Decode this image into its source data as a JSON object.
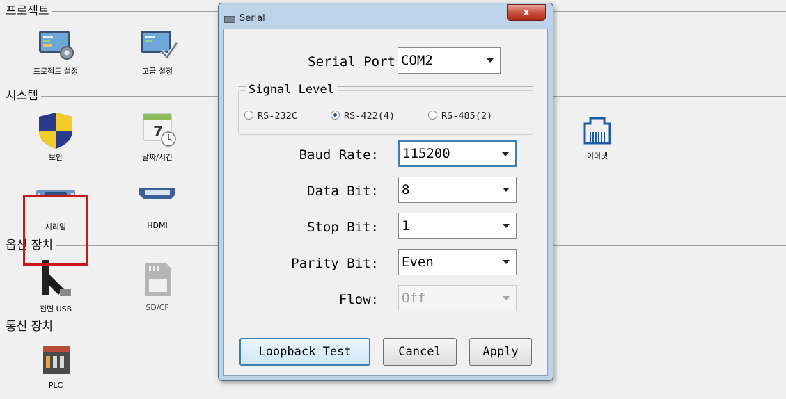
{
  "sections": {
    "project": "프로젝트",
    "system": "시스템",
    "option_device": "옵션 장치",
    "comm_device": "통신 장치"
  },
  "tiles": {
    "project_settings": "프로젝트 설정",
    "advanced_settings": "고급 설정",
    "security": "보안",
    "date_time": "날짜/시간",
    "ethernet": "이더넷",
    "serial": "시리얼",
    "hdmi": "HDMI",
    "front_usb": "전면 USB",
    "sd_cf": "SD/CF",
    "plc": "PLC"
  },
  "dialog": {
    "title": "Serial",
    "close": "x",
    "serial_port_label": "Serial Port",
    "serial_port_value": "COM2",
    "signal_level_title": "Signal Level",
    "signal_options": [
      "RS-232C",
      "RS-422(4)",
      "RS-485(2)"
    ],
    "signal_selected": "RS-422(4)",
    "baud_rate_label": "Baud Rate:",
    "baud_rate_value": "115200",
    "data_bit_label": "Data Bit:",
    "data_bit_value": "8",
    "stop_bit_label": "Stop Bit:",
    "stop_bit_value": "1",
    "parity_bit_label": "Parity Bit:",
    "parity_bit_value": "Even",
    "flow_label": "Flow:",
    "flow_value": "Off",
    "buttons": {
      "loopback": "Loopback Test",
      "cancel": "Cancel",
      "apply": "Apply"
    }
  },
  "colors": {
    "highlight_box": "#c8171e",
    "focus_border": "#3c7fb1",
    "dialog_frame": "#bcd3ea"
  }
}
